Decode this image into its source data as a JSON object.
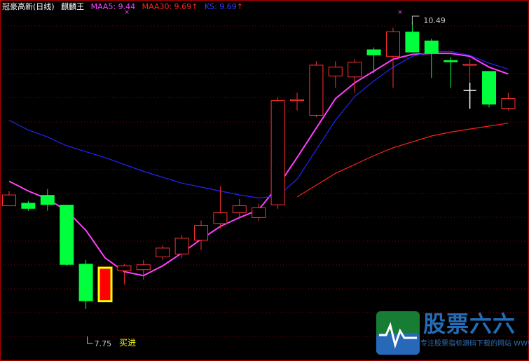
{
  "legend": {
    "title": "冠豪高新(日线)",
    "indicator": "麒麟王",
    "maa5_label": "MAA5: 9.44",
    "maa30_label": "MAA30: 9.69",
    "ks_label": "KS: 9.69",
    "arrow": "↑",
    "colors": {
      "maa5": "#ff40ff",
      "maa30": "#ff2020",
      "ks": "#3a3aff"
    }
  },
  "watermark": {
    "brand": "股票六六",
    "url": "专注股票指标源码下载的网站 WWW.GP66.CN"
  },
  "chart_data": {
    "type": "candlestick",
    "y_range": [
      7.4,
      10.8
    ],
    "up_color": "#ff3030",
    "down_color": "#00ff3c",
    "candles": [
      {
        "o": 8.85,
        "c": 8.96,
        "h": 9.0,
        "l": 8.85
      },
      {
        "o": 8.88,
        "c": 8.82,
        "h": 8.9,
        "l": 8.8
      },
      {
        "o": 8.96,
        "c": 8.86,
        "h": 9.02,
        "l": 8.8
      },
      {
        "o": 8.86,
        "c": 8.25,
        "h": 8.86,
        "l": 8.24
      },
      {
        "o": 8.26,
        "c": 7.88,
        "h": 8.3,
        "l": 7.8
      },
      {
        "o": 7.88,
        "c": 8.22,
        "h": 8.22,
        "l": 7.88,
        "signal": "yellow"
      },
      {
        "o": 8.19,
        "c": 8.24,
        "h": 8.26,
        "l": 8.05
      },
      {
        "o": 8.2,
        "c": 8.25,
        "h": 8.3,
        "l": 8.1
      },
      {
        "o": 8.33,
        "c": 8.42,
        "h": 8.45,
        "l": 8.3
      },
      {
        "o": 8.36,
        "c": 8.52,
        "h": 8.55,
        "l": 8.32
      },
      {
        "o": 8.5,
        "c": 8.65,
        "h": 8.7,
        "l": 8.4
      },
      {
        "o": 8.67,
        "c": 8.78,
        "h": 9.05,
        "l": 8.62
      },
      {
        "o": 8.78,
        "c": 8.85,
        "h": 8.92,
        "l": 8.72
      },
      {
        "o": 8.73,
        "c": 8.83,
        "h": 8.87,
        "l": 8.7
      },
      {
        "o": 8.86,
        "c": 9.92,
        "h": 9.95,
        "l": 8.82
      },
      {
        "o": 9.93,
        "c": 9.93,
        "h": 10.0,
        "l": 9.82
      },
      {
        "o": 9.77,
        "c": 10.28,
        "h": 10.32,
        "l": 9.75
      },
      {
        "o": 10.17,
        "c": 10.26,
        "h": 10.32,
        "l": 10.05
      },
      {
        "o": 10.16,
        "c": 10.31,
        "h": 10.34,
        "l": 10.0
      },
      {
        "o": 10.44,
        "c": 10.38,
        "h": 10.46,
        "l": 10.2
      },
      {
        "o": 10.37,
        "c": 10.62,
        "h": 10.66,
        "l": 10.05
      },
      {
        "o": 10.62,
        "c": 10.41,
        "h": 10.72,
        "l": 10.41
      },
      {
        "o": 10.53,
        "c": 10.4,
        "h": 10.55,
        "l": 10.15
      },
      {
        "o": 10.33,
        "c": 10.31,
        "h": 10.36,
        "l": 10.05
      },
      {
        "o": 10.28,
        "c": 10.29,
        "h": 10.34,
        "l": 10.1
      },
      {
        "o": 10.22,
        "c": 9.88,
        "h": 10.22,
        "l": 9.85
      },
      {
        "o": 9.84,
        "c": 9.94,
        "h": 10.0,
        "l": 9.82
      }
    ],
    "series": [
      {
        "name": "MAA5",
        "color": "#ff40ff",
        "values": [
          9.1,
          9.0,
          8.92,
          8.8,
          8.6,
          8.32,
          8.18,
          8.14,
          8.24,
          8.37,
          8.51,
          8.64,
          8.73,
          8.81,
          9.05,
          9.34,
          9.64,
          9.94,
          10.1,
          10.22,
          10.34,
          10.39,
          10.4,
          10.4,
          10.37,
          10.26,
          10.19
        ]
      },
      {
        "name": "MAA30",
        "color": "#ff2020",
        "values": [
          null,
          null,
          null,
          null,
          null,
          null,
          null,
          null,
          null,
          null,
          null,
          null,
          null,
          null,
          null,
          8.94,
          9.06,
          9.18,
          9.27,
          9.36,
          9.44,
          9.5,
          9.56,
          9.6,
          9.63,
          9.66,
          9.69
        ]
      },
      {
        "name": "KS",
        "color": "#2424ff",
        "values": [
          9.72,
          9.62,
          9.55,
          9.46,
          9.4,
          9.34,
          9.27,
          9.2,
          9.14,
          9.08,
          9.04,
          9.0,
          8.96,
          8.93,
          8.95,
          9.12,
          9.42,
          9.72,
          9.96,
          10.12,
          10.26,
          10.37,
          10.42,
          10.42,
          10.38,
          10.3,
          10.24
        ]
      }
    ],
    "annotations": [
      {
        "text": "10.49",
        "price": 10.49,
        "index": 21
      },
      {
        "text": "7.75",
        "price": 7.75,
        "index": 4
      },
      {
        "text": "买进",
        "price": 7.75,
        "index": 6
      }
    ],
    "grid": true
  }
}
